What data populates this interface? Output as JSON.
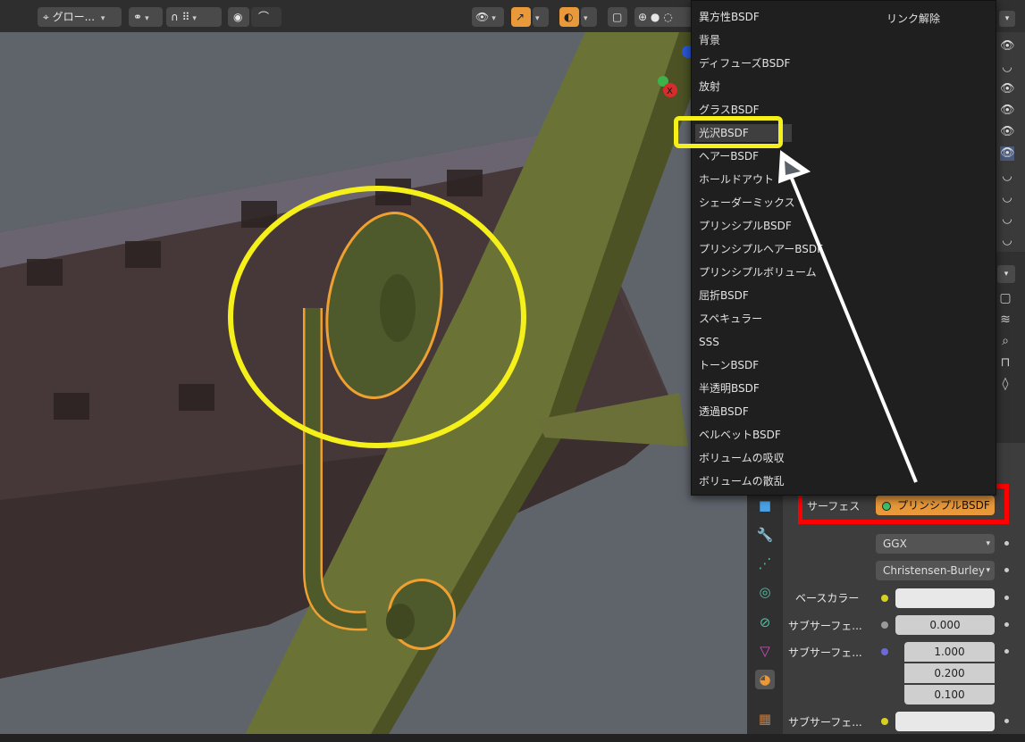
{
  "header": {
    "transform_label": "グロー...",
    "colors": {
      "accent": "#e9993a",
      "bar": "#2e2e2e"
    }
  },
  "add_shader_menu": {
    "items": [
      "異方性BSDF",
      "背景",
      "ディフューズBSDF",
      "放射",
      "グラスBSDF",
      "光沢BSDF",
      "ヘアーBSDF",
      "ホールドアウト",
      "シェーダーミックス",
      "プリンシプルBSDF",
      "プリンシプルヘアーBSDF",
      "プリンシプルボリューム",
      "屈折BSDF",
      "スペキュラー",
      "SSS",
      "トーンBSDF",
      "半透明BSDF",
      "透過BSDF",
      "ベルベットBSDF",
      "ボリュームの吸収",
      "ボリュームの散乱"
    ],
    "highlighted": "光沢BSDF",
    "unlink_label": "リンク解除"
  },
  "properties": {
    "surface_label": "サーフェス",
    "surface_value": "プリンシプルBSDF",
    "distribution": "GGX",
    "subsurface_method": "Christensen-Burley",
    "base_color_label": "ベースカラー",
    "subsurface_label": "サブサーフェ...",
    "subsurface_value": "0.000",
    "subsurface_radius_label": "サブサーフェ...",
    "subsurface_radius": [
      "1.000",
      "0.200",
      "0.100"
    ],
    "subsurface_color_label": "サブサーフェ..."
  },
  "annotation_colors": {
    "circle": "#f5f01a",
    "box": "#ff0000",
    "arrow": "#ffffff"
  }
}
